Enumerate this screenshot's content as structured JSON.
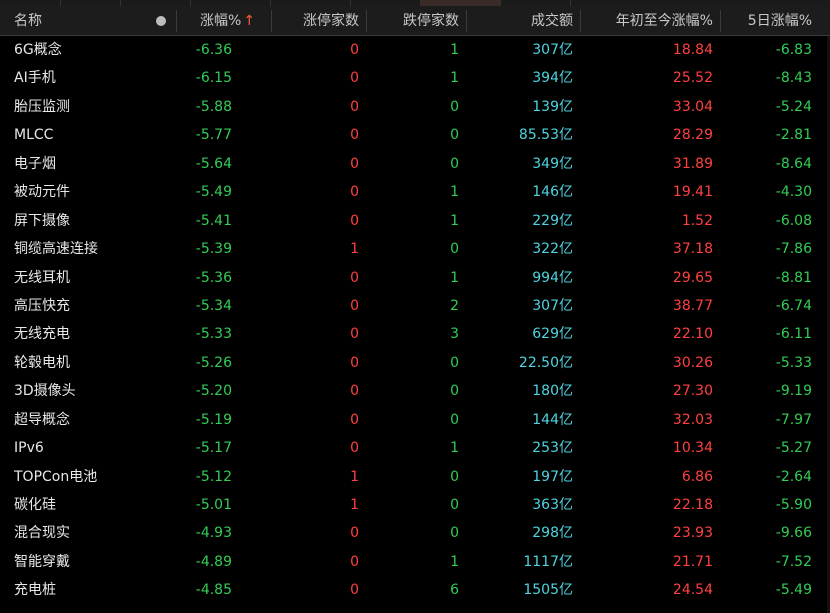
{
  "colors": {
    "up": "#ff4040",
    "down": "#33cc55",
    "amount": "#4fd3e0",
    "accent": "#ff5a3a"
  },
  "header": {
    "name": "名称",
    "change_pct": "涨幅%",
    "sort_icon": "↑",
    "limit_up": "涨停家数",
    "limit_down": "跌停家数",
    "volume": "成交额",
    "ytd_change": "年初至今涨幅%",
    "five_day": "5日涨幅%"
  },
  "rows": [
    {
      "name": "6G概念",
      "change": "-6.36",
      "limit_up": "0",
      "limit_down": "1",
      "volume": "307亿",
      "ytd": "18.84",
      "five_day": "-6.83"
    },
    {
      "name": "AI手机",
      "change": "-6.15",
      "limit_up": "0",
      "limit_down": "1",
      "volume": "394亿",
      "ytd": "25.52",
      "five_day": "-8.43"
    },
    {
      "name": "胎压监测",
      "change": "-5.88",
      "limit_up": "0",
      "limit_down": "0",
      "volume": "139亿",
      "ytd": "33.04",
      "five_day": "-5.24"
    },
    {
      "name": "MLCC",
      "change": "-5.77",
      "limit_up": "0",
      "limit_down": "0",
      "volume": "85.53亿",
      "ytd": "28.29",
      "five_day": "-2.81"
    },
    {
      "name": "电子烟",
      "change": "-5.64",
      "limit_up": "0",
      "limit_down": "0",
      "volume": "349亿",
      "ytd": "31.89",
      "five_day": "-8.64"
    },
    {
      "name": "被动元件",
      "change": "-5.49",
      "limit_up": "0",
      "limit_down": "1",
      "volume": "146亿",
      "ytd": "19.41",
      "five_day": "-4.30"
    },
    {
      "name": "屏下摄像",
      "change": "-5.41",
      "limit_up": "0",
      "limit_down": "1",
      "volume": "229亿",
      "ytd": "1.52",
      "five_day": "-6.08"
    },
    {
      "name": "铜缆高速连接",
      "change": "-5.39",
      "limit_up": "1",
      "limit_down": "0",
      "volume": "322亿",
      "ytd": "37.18",
      "five_day": "-7.86"
    },
    {
      "name": "无线耳机",
      "change": "-5.36",
      "limit_up": "0",
      "limit_down": "1",
      "volume": "994亿",
      "ytd": "29.65",
      "five_day": "-8.81"
    },
    {
      "name": "高压快充",
      "change": "-5.34",
      "limit_up": "0",
      "limit_down": "2",
      "volume": "307亿",
      "ytd": "38.77",
      "five_day": "-6.74"
    },
    {
      "name": "无线充电",
      "change": "-5.33",
      "limit_up": "0",
      "limit_down": "3",
      "volume": "629亿",
      "ytd": "22.10",
      "five_day": "-6.11"
    },
    {
      "name": "轮毂电机",
      "change": "-5.26",
      "limit_up": "0",
      "limit_down": "0",
      "volume": "22.50亿",
      "ytd": "30.26",
      "five_day": "-5.33"
    },
    {
      "name": "3D摄像头",
      "change": "-5.20",
      "limit_up": "0",
      "limit_down": "0",
      "volume": "180亿",
      "ytd": "27.30",
      "five_day": "-9.19"
    },
    {
      "name": "超导概念",
      "change": "-5.19",
      "limit_up": "0",
      "limit_down": "0",
      "volume": "144亿",
      "ytd": "32.03",
      "five_day": "-7.97"
    },
    {
      "name": "IPv6",
      "change": "-5.17",
      "limit_up": "0",
      "limit_down": "1",
      "volume": "253亿",
      "ytd": "10.34",
      "five_day": "-5.27"
    },
    {
      "name": "TOPCon电池",
      "change": "-5.12",
      "limit_up": "1",
      "limit_down": "0",
      "volume": "197亿",
      "ytd": "6.86",
      "five_day": "-2.64"
    },
    {
      "name": "碳化硅",
      "change": "-5.01",
      "limit_up": "1",
      "limit_down": "0",
      "volume": "363亿",
      "ytd": "22.18",
      "five_day": "-5.90"
    },
    {
      "name": "混合现实",
      "change": "-4.93",
      "limit_up": "0",
      "limit_down": "0",
      "volume": "298亿",
      "ytd": "23.93",
      "five_day": "-9.66"
    },
    {
      "name": "智能穿戴",
      "change": "-4.89",
      "limit_up": "0",
      "limit_down": "1",
      "volume": "1117亿",
      "ytd": "21.71",
      "five_day": "-7.52"
    },
    {
      "name": "充电桩",
      "change": "-4.85",
      "limit_up": "0",
      "limit_down": "6",
      "volume": "1505亿",
      "ytd": "24.54",
      "five_day": "-5.49"
    }
  ]
}
